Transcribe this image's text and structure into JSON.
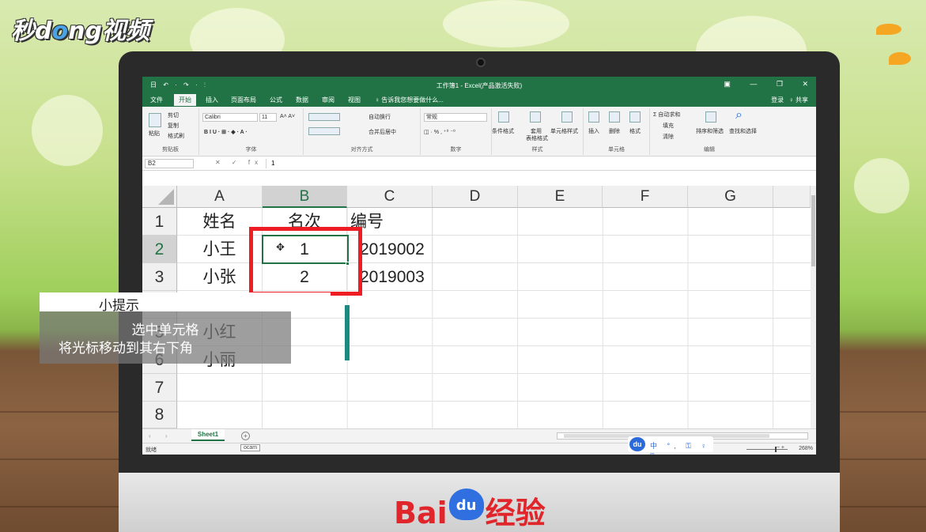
{
  "brand": {
    "prefix": "秒d",
    "o": "o",
    "suffix": "ng视频"
  },
  "footer": {
    "left": "Bai",
    "paw": "du",
    "right": "经验"
  },
  "excel": {
    "window_title": "工作簿1 - Excel(产品激活失败)",
    "quick_access": "日 ↶ · ↷ · ⫶",
    "window_controls": [
      "▣",
      "—",
      "❐",
      "✕"
    ],
    "tabs": [
      "文件",
      "开始",
      "插入",
      "页面布局",
      "公式",
      "数据",
      "审阅",
      "视图"
    ],
    "tell_me": "♀ 告诉我您想要做什么...",
    "login": "登录",
    "share": "♀ 共享",
    "ribbon": {
      "groups": [
        "剪贴板",
        "字体",
        "对齐方式",
        "数字",
        "样式",
        "单元格",
        "编辑"
      ],
      "cut": "剪切",
      "copy": "复制",
      "format_painter": "格式刷",
      "paste": "粘贴",
      "font_name": "Calibri",
      "font_size": "11",
      "font_buttons": "B  I  U  ·  ⊞ ·  ◆ ·  A ·",
      "font_grow": "A˄ A˅",
      "wrap_text": "自动换行",
      "merge_center": "合并后居中",
      "number_format": "常规",
      "number_buttons": "◫ · %  ,   ⁺⁰ ⁻⁰",
      "conditional_format": "条件格式",
      "table_format_line1": "套用",
      "table_format_line2": "表格格式",
      "cell_styles": "单元格样式",
      "insert": "插入",
      "delete": "删除",
      "format": "格式",
      "autosum": "Σ 自动求和",
      "fill": "填充",
      "clear": "清除",
      "sort_filter": "排序和筛选",
      "find_select": "查找和选择"
    },
    "name_box": "B2",
    "fx_buttons": "✕ ✓ fx",
    "formula_value": "1",
    "columns": [
      "A",
      "B",
      "C",
      "D",
      "E",
      "F",
      "G"
    ],
    "rows": [
      "1",
      "2",
      "3",
      "4",
      "5",
      "6",
      "7",
      "8"
    ],
    "cells": {
      "A1": "姓名",
      "B1": "名次",
      "C1": "编号",
      "A2": "小王",
      "B2": "1",
      "C2": "2019002",
      "A3": "小张",
      "B3": "2",
      "C3": "2019003",
      "A5": "小红",
      "A6": "小丽"
    },
    "sheet_nav": "‹ ›",
    "sheet_tab": "Sheet1",
    "add_sheet": "+",
    "status": "就绪",
    "ocam": "ocam",
    "ime_logo": "du",
    "ime_tools": "中 °, ⚿ ♀ ⊞",
    "zoom": "268%",
    "zoom_minus_plus": "−       +"
  },
  "tip": {
    "title": "小提示",
    "line1": "选中单元格",
    "line2": "将光标移动到其右下角"
  },
  "colors": {
    "excel_green": "#217346",
    "highlight_red": "#ee1d24",
    "tip_teal": "#1a8a82"
  }
}
